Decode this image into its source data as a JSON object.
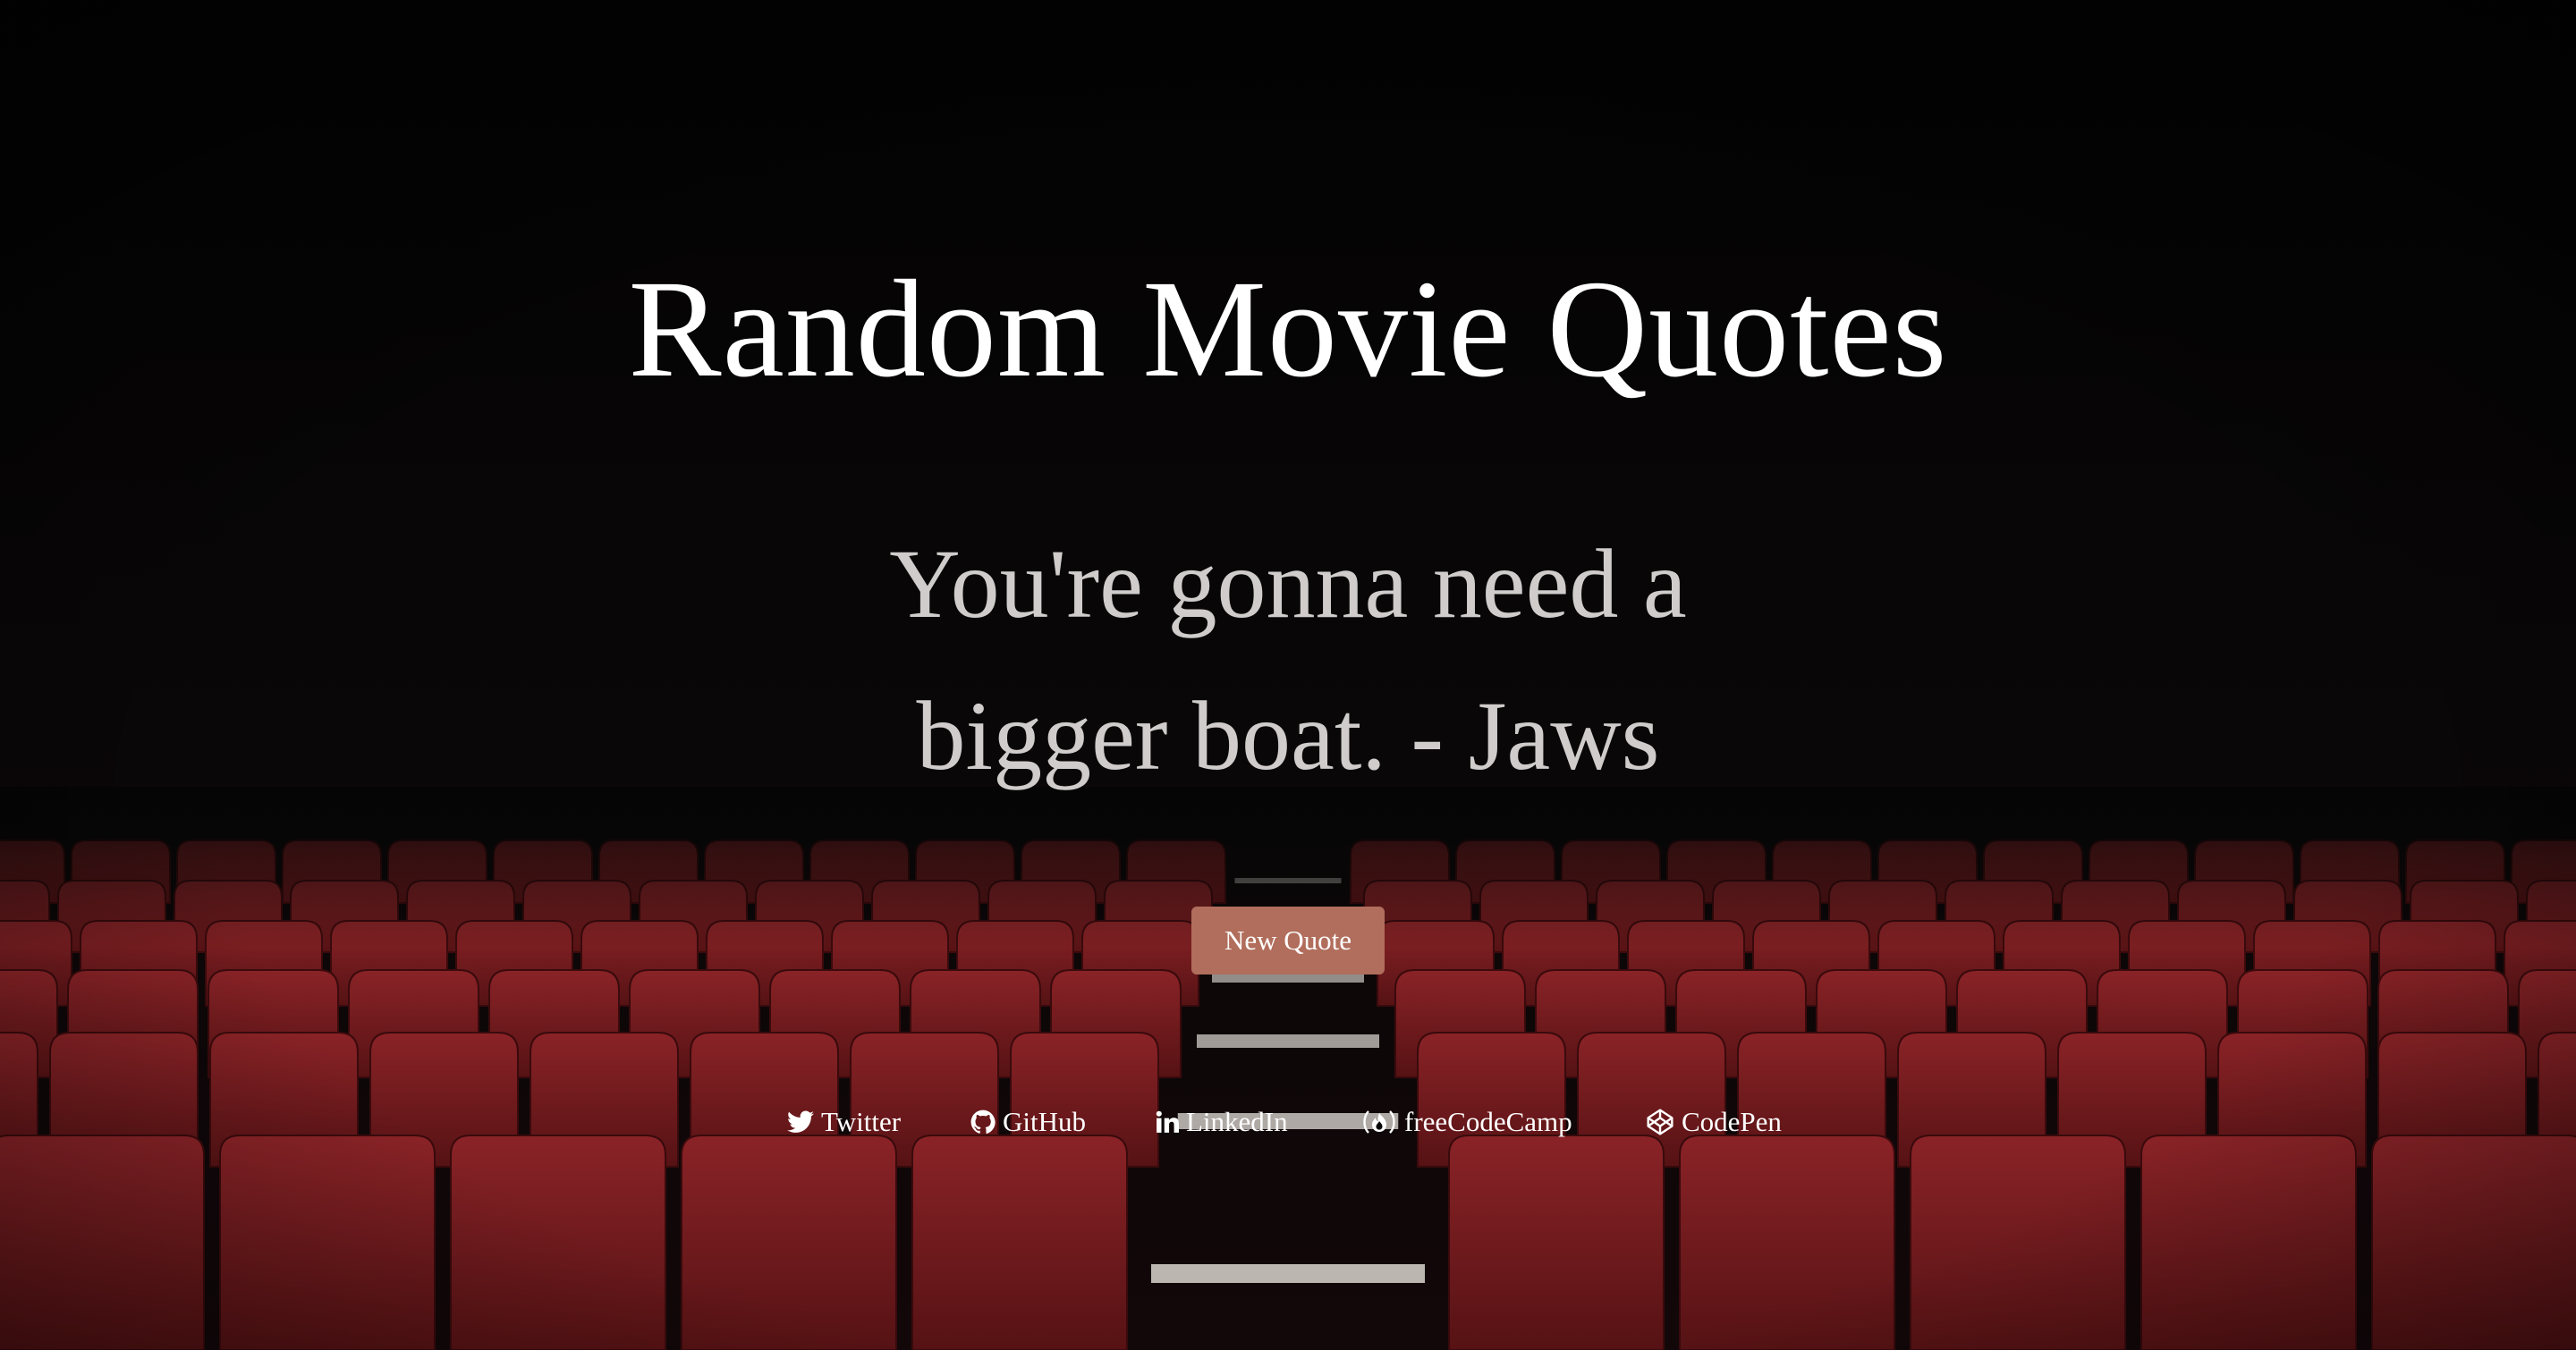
{
  "page": {
    "title": "Random Movie Quotes",
    "quote": "You're gonna need a bigger boat. - Jaws",
    "new_quote_label": "New Quote"
  },
  "links": [
    {
      "label": "Twitter",
      "icon": "twitter-icon"
    },
    {
      "label": "GitHub",
      "icon": "github-icon"
    },
    {
      "label": "LinkedIn",
      "icon": "linkedin-icon"
    },
    {
      "label": "freeCodeCamp",
      "icon": "freecodecamp-icon"
    },
    {
      "label": "CodePen",
      "icon": "codepen-icon"
    }
  ],
  "colors": {
    "background": "#050505",
    "seat": "#7a1c1f",
    "button": "#b16e5c",
    "quote_text": "#d0cccb",
    "title_text": "#ffffff"
  }
}
